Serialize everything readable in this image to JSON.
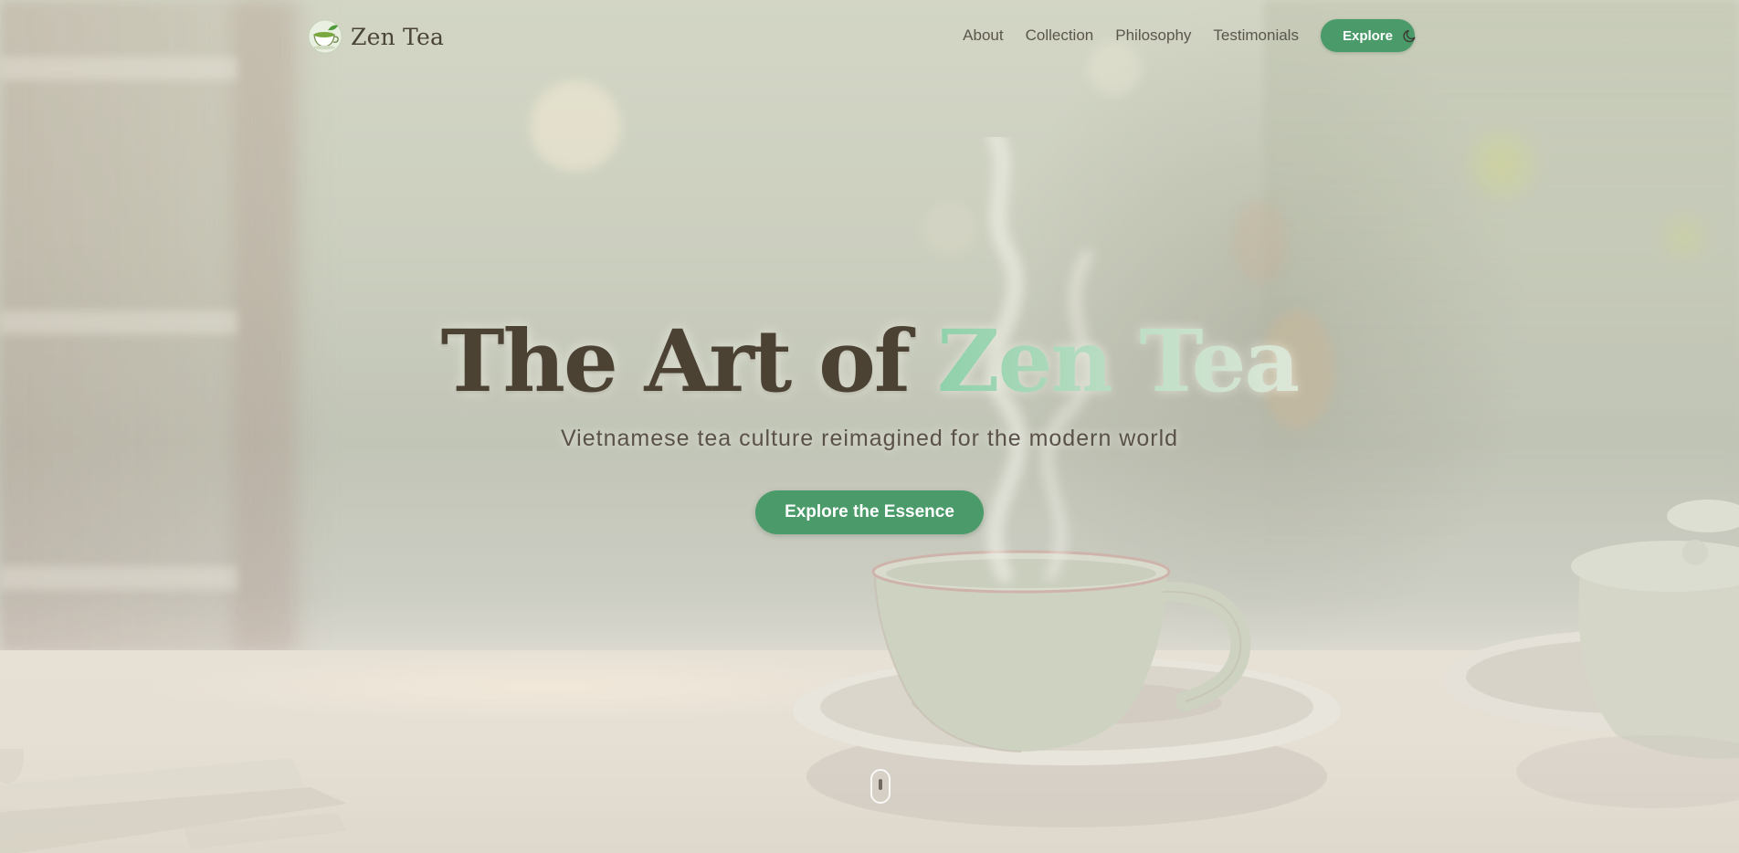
{
  "brand": {
    "name": "Zen Tea",
    "logo_icon": "tea-cup-icon"
  },
  "nav": {
    "links": [
      "About",
      "Collection",
      "Philosophy",
      "Testimonials"
    ],
    "cta_label": "Explore",
    "theme_toggle_icon": "moon-icon"
  },
  "hero": {
    "title_prefix": "The Art of",
    "title_accent": "Zen Tea",
    "subtitle": "Vietnamese tea culture reimagined for the modern world",
    "cta_label": "Explore the Essence",
    "scroll_icon": "mouse-scroll-icon"
  },
  "colors": {
    "accent": "#4a9b69",
    "title_text": "#4b4234",
    "accent_gradient_start": "#8fd1aa",
    "accent_gradient_end": "#dde7d8",
    "body_text": "#5b564c"
  }
}
